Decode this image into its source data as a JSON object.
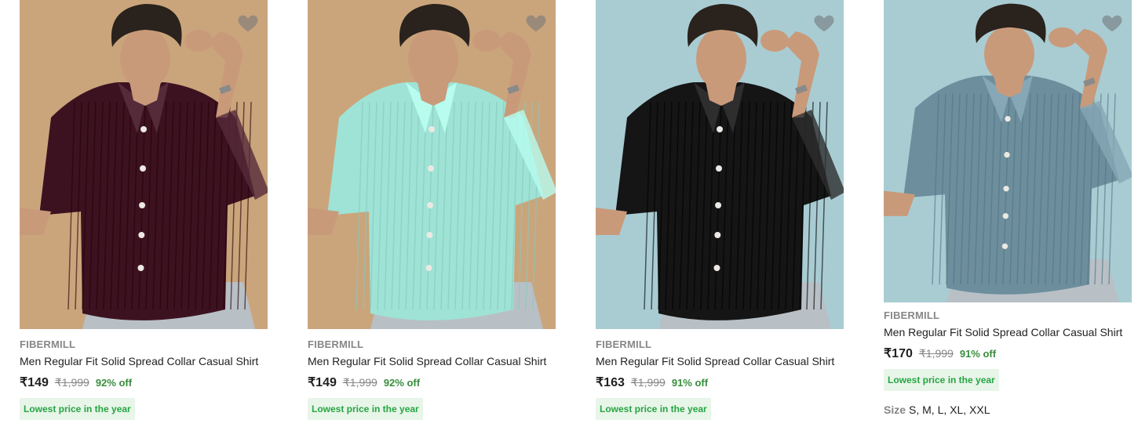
{
  "products": [
    {
      "brand": "FIBERMILL",
      "title": "Men Regular Fit Solid Spread Collar Casual Shirt",
      "price": "₹149",
      "mrp": "₹1,999",
      "discount": "92% off",
      "badge": "Lowest price in the year",
      "shirt_color": "#3d1220",
      "bg_color": "#caa57c",
      "wishlist_icon": "heart-icon"
    },
    {
      "brand": "FIBERMILL",
      "title": "Men Regular Fit Solid Spread Collar Casual Shirt",
      "price": "₹149",
      "mrp": "₹1,999",
      "discount": "92% off",
      "badge": "Lowest price in the year",
      "shirt_color": "#9ee3d6",
      "bg_color": "#caa57c",
      "wishlist_icon": "heart-icon"
    },
    {
      "brand": "FIBERMILL",
      "title": "Men Regular Fit Solid Spread Collar Casual Shirt",
      "price": "₹163",
      "mrp": "₹1,999",
      "discount": "91% off",
      "badge": "Lowest price in the year",
      "shirt_color": "#151515",
      "bg_color": "#a9ccd3",
      "wishlist_icon": "heart-icon"
    },
    {
      "brand": "FIBERMILL",
      "title": "Men Regular Fit Solid Spread Collar Casual Shirt",
      "price": "₹170",
      "mrp": "₹1,999",
      "discount": "91% off",
      "badge": "Lowest price in the year",
      "size_label": "Size",
      "sizes": "S, M, L, XL, XXL",
      "shirt_color": "#6d8e9d",
      "bg_color": "#a9ccd3",
      "wishlist_icon": "heart-icon"
    }
  ]
}
